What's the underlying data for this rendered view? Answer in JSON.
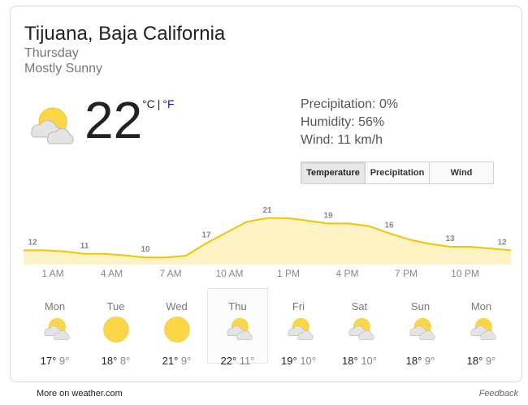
{
  "header": {
    "location": "Tijuana, Baja California",
    "day": "Thursday",
    "condition": "Mostly Sunny"
  },
  "current": {
    "icon": "partly-sunny-icon",
    "temperature": "22",
    "unit_c": "°C",
    "unit_sep": "|",
    "unit_f": "°F",
    "precipitation": "Precipitation: 0%",
    "humidity": "Humidity: 56%",
    "wind": "Wind: 11 km/h"
  },
  "tabs": [
    {
      "label": "Temperature",
      "active": true
    },
    {
      "label": "Precipitation",
      "active": false
    },
    {
      "label": "Wind",
      "active": false
    }
  ],
  "chart_data": {
    "type": "area",
    "x": [
      0,
      1,
      2,
      3,
      4,
      5,
      6,
      7,
      8,
      9,
      10,
      11,
      12,
      13,
      14,
      15,
      16,
      17,
      18,
      19,
      20,
      21,
      22,
      23,
      24
    ],
    "values": [
      12,
      12,
      11.7,
      11,
      11,
      10.6,
      10,
      10,
      10.5,
      14,
      17,
      20,
      21,
      21,
      20.3,
      19.5,
      19.5,
      18.8,
      16.8,
      15,
      13.8,
      13,
      13,
      12.5,
      12
    ],
    "labels": [
      {
        "index": 0,
        "text": "12"
      },
      {
        "index": 3,
        "text": "11"
      },
      {
        "index": 6,
        "text": "10"
      },
      {
        "index": 9,
        "text": "17"
      },
      {
        "index": 12,
        "text": "21"
      },
      {
        "index": 15,
        "text": "19"
      },
      {
        "index": 18,
        "text": "16"
      },
      {
        "index": 21,
        "text": "13"
      },
      {
        "index": 24,
        "text": "12"
      }
    ],
    "hours": [
      "1 AM",
      "4 AM",
      "7 AM",
      "10 AM",
      "1 PM",
      "4 PM",
      "7 PM",
      "10 PM"
    ],
    "ylim": [
      8,
      23
    ],
    "colors": {
      "line": "#f5c400",
      "fill": "#fdf3c4",
      "label": "#878787"
    }
  },
  "forecast": [
    {
      "day": "Mon",
      "icon": "partly-sunny-icon",
      "high": "17°",
      "low": "9°",
      "selected": false
    },
    {
      "day": "Tue",
      "icon": "sunny-icon",
      "high": "18°",
      "low": "8°",
      "selected": false
    },
    {
      "day": "Wed",
      "icon": "sunny-icon",
      "high": "21°",
      "low": "9°",
      "selected": false
    },
    {
      "day": "Thu",
      "icon": "partly-sunny-icon",
      "high": "22°",
      "low": "11°",
      "selected": true
    },
    {
      "day": "Fri",
      "icon": "partly-sunny-icon",
      "high": "19°",
      "low": "10°",
      "selected": false
    },
    {
      "day": "Sat",
      "icon": "partly-sunny-icon",
      "high": "18°",
      "low": "10°",
      "selected": false
    },
    {
      "day": "Sun",
      "icon": "partly-sunny-icon",
      "high": "18°",
      "low": "9°",
      "selected": false
    },
    {
      "day": "Mon",
      "icon": "partly-sunny-icon",
      "high": "18°",
      "low": "9°",
      "selected": false
    }
  ],
  "footer": {
    "more_link": "More on weather.com",
    "feedback": "Feedback"
  },
  "colors": {
    "sun": "#fbd646",
    "sun_edge": "#f0c419",
    "cloud": "#e4e4e4",
    "cloud_edge": "#b8b8b8",
    "link": "#1a0dab"
  }
}
